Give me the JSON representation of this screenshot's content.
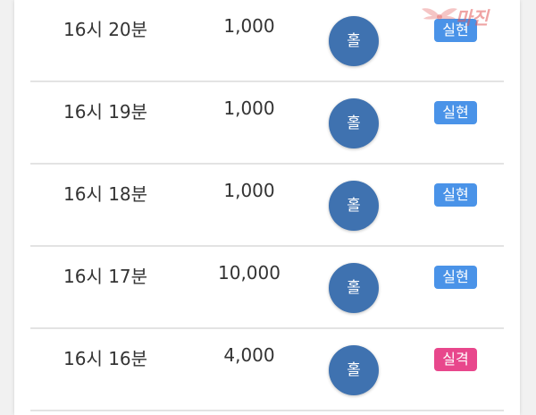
{
  "colors": {
    "pick_circle": "#3f72b0",
    "badge_success": "#4a93e8",
    "badge_fail": "#e8478c"
  },
  "rows": [
    {
      "time": "16시 20분",
      "amount": "1,000",
      "pick": "홀",
      "result": "실현",
      "status": "success"
    },
    {
      "time": "16시 19분",
      "amount": "1,000",
      "pick": "홀",
      "result": "실현",
      "status": "success"
    },
    {
      "time": "16시 18분",
      "amount": "1,000",
      "pick": "홀",
      "result": "실현",
      "status": "success"
    },
    {
      "time": "16시 17분",
      "amount": "10,000",
      "pick": "홀",
      "result": "실현",
      "status": "success"
    },
    {
      "time": "16시 16분",
      "amount": "4,000",
      "pick": "홀",
      "result": "실격",
      "status": "fail"
    }
  ],
  "watermark": {
    "logo": "마진",
    "icon": "wings-icon"
  }
}
